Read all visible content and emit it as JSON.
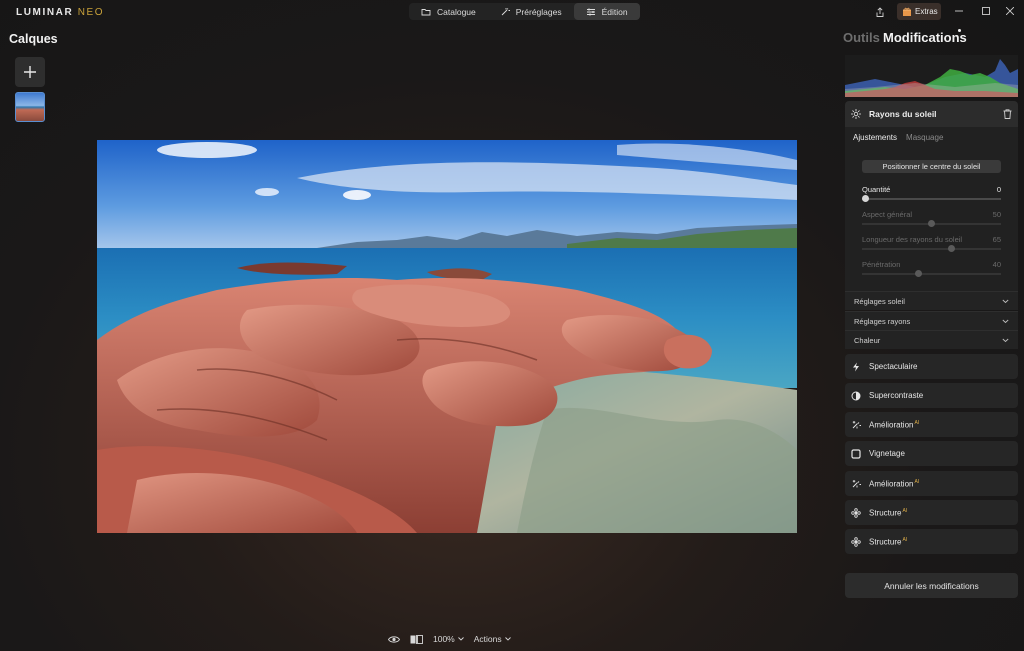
{
  "app": {
    "logo_main": "LUMINAR",
    "logo_sub": "NEO"
  },
  "mode_tabs": [
    {
      "label": "Catalogue",
      "icon": "folder-icon",
      "active": false
    },
    {
      "label": "Préréglages",
      "icon": "magic-wand-icon",
      "active": false
    },
    {
      "label": "Édition",
      "icon": "sliders-icon",
      "active": true
    }
  ],
  "topbar": {
    "extras_label": "Extras",
    "window_controls": [
      "minimize",
      "maximize",
      "close"
    ]
  },
  "left_panel": {
    "title": "Calques",
    "add_layer_icon": "plus-icon"
  },
  "bottom_bar": {
    "zoom": "100%",
    "actions_label": "Actions"
  },
  "right_panel": {
    "tab_tools": "Outils",
    "tab_edits": "Modifications",
    "active_tool": {
      "title": "Rayons du soleil",
      "subtabs": [
        "Ajustements",
        "Masquage"
      ],
      "position_button": "Positionner le centre du soleil",
      "sliders": [
        {
          "label": "Quantité",
          "value": "0",
          "fraction": 0.0,
          "enabled": true
        },
        {
          "label": "Aspect général",
          "value": "50",
          "fraction": 0.5,
          "enabled": false
        },
        {
          "label": "Longueur des rayons du soleil",
          "value": "65",
          "fraction": 0.65,
          "enabled": false
        },
        {
          "label": "Pénétration",
          "value": "40",
          "fraction": 0.4,
          "enabled": false
        }
      ],
      "sections": [
        "Réglages soleil",
        "Réglages rayons",
        "Chaleur"
      ]
    },
    "applied_tools": [
      {
        "label": "Spectaculaire",
        "icon": "lightning-icon",
        "ai": false
      },
      {
        "label": "Supercontraste",
        "icon": "contrast-icon",
        "ai": false
      },
      {
        "label": "Amélioration",
        "icon": "sparkle-icon",
        "ai": true
      },
      {
        "label": "Vignetage",
        "icon": "vignette-icon",
        "ai": false
      },
      {
        "label": "Amélioration",
        "icon": "sparkle-icon",
        "ai": true
      },
      {
        "label": "Structure",
        "icon": "flower-icon",
        "ai": true
      },
      {
        "label": "Structure",
        "icon": "flower-icon",
        "ai": true
      }
    ],
    "ai_badge": "AI",
    "undo_label": "Annuler les modifications"
  }
}
